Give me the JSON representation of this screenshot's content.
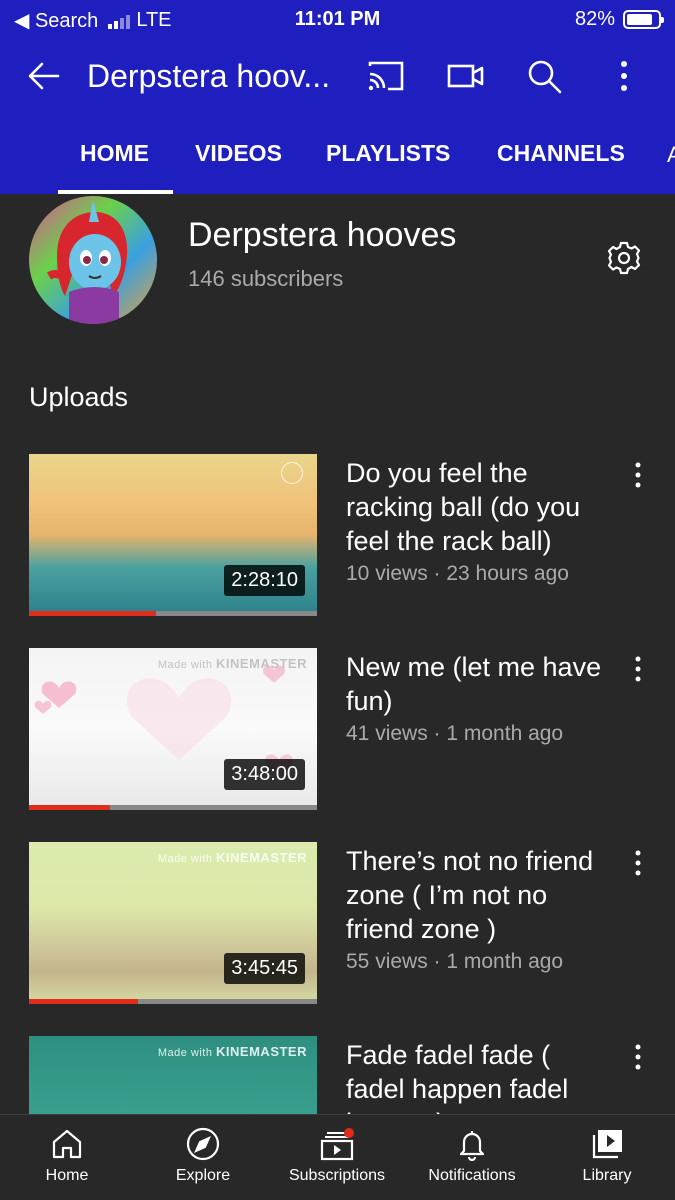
{
  "status": {
    "back_app": "Search",
    "network": "LTE",
    "time": "11:01 PM",
    "battery": "82%",
    "battery_level": 0.82
  },
  "appbar": {
    "title": "Derpstera hoov..."
  },
  "tabs": [
    {
      "label": "HOME"
    },
    {
      "label": "VIDEOS"
    },
    {
      "label": "PLAYLISTS"
    },
    {
      "label": "CHANNELS"
    }
  ],
  "channel": {
    "name": "Derpstera hooves",
    "subscribers": "146 subscribers"
  },
  "uploads_label": "Uploads",
  "videos": [
    {
      "title": "Do you feel the racking ball (do you feel the rack ball)",
      "meta": "10 views · 23 hours ago",
      "duration": "2:28:10",
      "watched_fraction": 0.44
    },
    {
      "title": "New me (let me have fun)",
      "meta": "41 views · 1 month ago",
      "duration": "3:48:00",
      "watched_fraction": 0.28,
      "watermark_small": "Made with",
      "watermark_big": "KINEMASTER"
    },
    {
      "title": "There’s not no friend zone ( I’m not no friend zone )",
      "meta": "55 views · 1 month ago",
      "duration": "3:45:45",
      "watched_fraction": 0.38,
      "watermark_small": "Made with",
      "watermark_big": "KINEMASTER"
    },
    {
      "title": "Fade fadel fade ( fadel happen fadel happen)",
      "watermark_small": "Made with",
      "watermark_big": "KINEMASTER"
    }
  ],
  "nav": [
    {
      "label": "Home",
      "icon": "home-icon"
    },
    {
      "label": "Explore",
      "icon": "compass-icon"
    },
    {
      "label": "Subscriptions",
      "icon": "subscriptions-icon"
    },
    {
      "label": "Notifications",
      "icon": "bell-icon"
    },
    {
      "label": "Library",
      "icon": "library-icon"
    }
  ],
  "colors": {
    "header_bg": "#1f1fc0",
    "page_bg": "#282828",
    "progress_red": "#e32b1c",
    "secondary_text": "#aaaaaa"
  }
}
